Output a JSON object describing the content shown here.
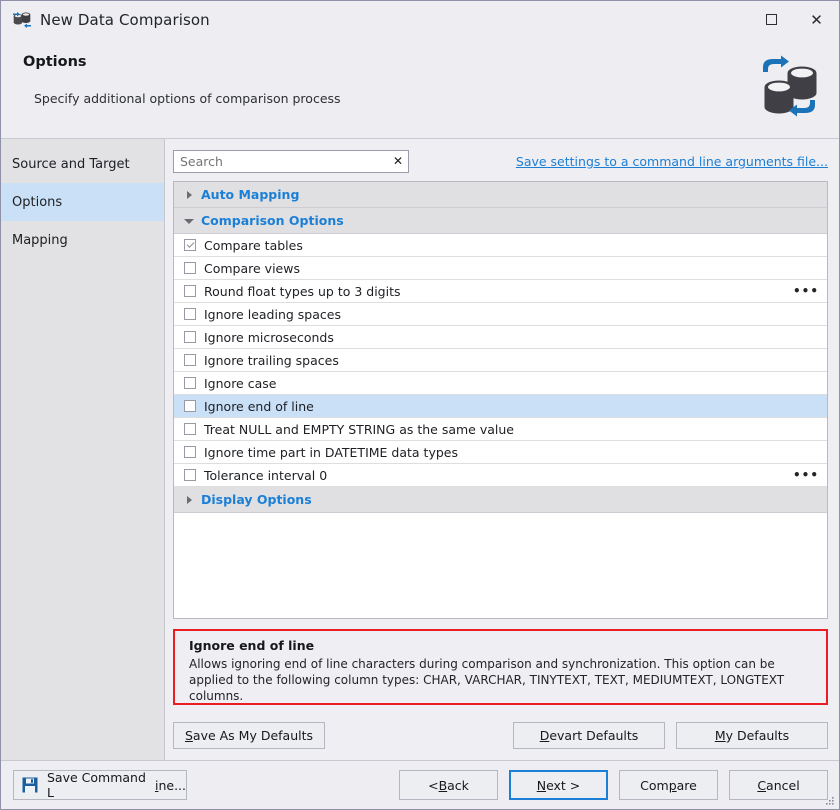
{
  "window": {
    "title": "New Data Comparison",
    "app_icon": "database-compare-icon",
    "controls": {
      "maximize": "maximize-icon",
      "close": "✕"
    }
  },
  "header": {
    "title": "Options",
    "subtitle": "Specify additional options of comparison process",
    "icon": "database-sync-icon"
  },
  "sidebar": {
    "items": [
      {
        "label": "Source and Target",
        "active": false
      },
      {
        "label": "Options",
        "active": true
      },
      {
        "label": "Mapping",
        "active": false
      }
    ]
  },
  "search": {
    "value": "",
    "placeholder": "Search",
    "clear_glyph": "✕"
  },
  "save_settings_link": "Save settings to a command line arguments file...",
  "options": {
    "groups": [
      {
        "label": "Auto Mapping",
        "expanded": false,
        "rows": []
      },
      {
        "label": "Comparison Options",
        "expanded": true,
        "rows": [
          {
            "label": "Compare tables",
            "checked": true,
            "selected": false,
            "ellipsis": false
          },
          {
            "label": "Compare views",
            "checked": false,
            "selected": false,
            "ellipsis": false
          },
          {
            "label": "Round float types up to 3 digits",
            "checked": false,
            "selected": false,
            "ellipsis": true
          },
          {
            "label": "Ignore leading spaces",
            "checked": false,
            "selected": false,
            "ellipsis": false
          },
          {
            "label": "Ignore microseconds",
            "checked": false,
            "selected": false,
            "ellipsis": false
          },
          {
            "label": "Ignore trailing spaces",
            "checked": false,
            "selected": false,
            "ellipsis": false
          },
          {
            "label": "Ignore case",
            "checked": false,
            "selected": false,
            "ellipsis": false
          },
          {
            "label": "Ignore end of line",
            "checked": false,
            "selected": true,
            "ellipsis": false
          },
          {
            "label": "Treat NULL and EMPTY STRING as the same value",
            "checked": false,
            "selected": false,
            "ellipsis": false
          },
          {
            "label": "Ignore time part in DATETIME data types",
            "checked": false,
            "selected": false,
            "ellipsis": false
          },
          {
            "label": "Tolerance interval 0",
            "checked": false,
            "selected": false,
            "ellipsis": true
          }
        ]
      },
      {
        "label": "Display Options",
        "expanded": false,
        "rows": []
      }
    ],
    "ellipsis_glyph": "•••"
  },
  "description": {
    "title": "Ignore end of line",
    "text": "Allows ignoring end of line characters during comparison and synchronization. This option can be applied to the following column types: CHAR, VARCHAR, TINYTEXT, TEXT, MEDIUMTEXT, LONGTEXT columns."
  },
  "defaults_buttons": {
    "save_as_my_defaults": {
      "pre": "S",
      "post": "ave As My Defaults"
    },
    "devart_defaults": {
      "pre": "D",
      "post": "evart Defaults"
    },
    "my_defaults": {
      "pre": "M",
      "post": "y Defaults"
    }
  },
  "footer": {
    "save_command_line": {
      "pre": "Save Command L",
      "accel": "i",
      "post": "ne..."
    },
    "back": {
      "pre": "< ",
      "accel": "B",
      "post": "ack"
    },
    "next": {
      "pre": "",
      "accel": "N",
      "post": "ext >"
    },
    "compare": {
      "pre": "Com",
      "accel": "p",
      "post": "are"
    },
    "cancel": {
      "pre": "",
      "accel": "C",
      "post": "ancel"
    }
  },
  "colors": {
    "accent_blue": "#1c7fd6",
    "selection_blue": "#c9e0f7",
    "alert_red": "#ec1c24",
    "window_bg": "#efeff3",
    "sidebar_bg": "#e2e2e4"
  }
}
